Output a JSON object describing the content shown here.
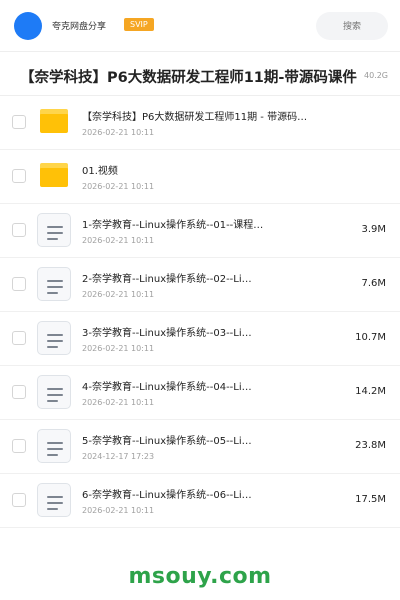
{
  "header": {
    "share_name": "夸克网盘分享",
    "badge": "SVIP",
    "search_placeholder": "搜索"
  },
  "folder": {
    "title": "【奈学科技】P6大数据研发工程师11期-带源码课件",
    "total_size": "40.2G"
  },
  "files": [
    {
      "type": "folder",
      "name": "【奈学科技】P6大数据研发工程师11期 - 带源码…",
      "date": "2026-02-21 10:11",
      "size": ""
    },
    {
      "type": "folder",
      "name": "01.视频",
      "date": "2026-02-21 10:11",
      "size": ""
    },
    {
      "type": "doc",
      "name": "1-奈学教育--Linux操作系统--01--课程…",
      "date": "2026-02-21 10:11",
      "size": "3.9M"
    },
    {
      "type": "doc",
      "name": "2-奈学教育--Linux操作系统--02--Li…",
      "date": "2026-02-21 10:11",
      "size": "7.6M"
    },
    {
      "type": "doc",
      "name": "3-奈学教育--Linux操作系统--03--Li…",
      "date": "2026-02-21 10:11",
      "size": "10.7M"
    },
    {
      "type": "doc",
      "name": "4-奈学教育--Linux操作系统--04--Li…",
      "date": "2026-02-21 10:11",
      "size": "14.2M"
    },
    {
      "type": "doc",
      "name": "5-奈学教育--Linux操作系统--05--Li…",
      "date": "2024-12-17 17:23",
      "size": "23.8M"
    },
    {
      "type": "doc",
      "name": "6-奈学教育--Linux操作系统--06--Li…",
      "date": "2026-02-21 10:11",
      "size": "17.5M"
    }
  ],
  "watermark": "msouy.com",
  "colors": {
    "avatar": "#1e7bf6",
    "svip": "#f5a623",
    "folder": "#ffc107",
    "watermark": "#2ea34a"
  }
}
